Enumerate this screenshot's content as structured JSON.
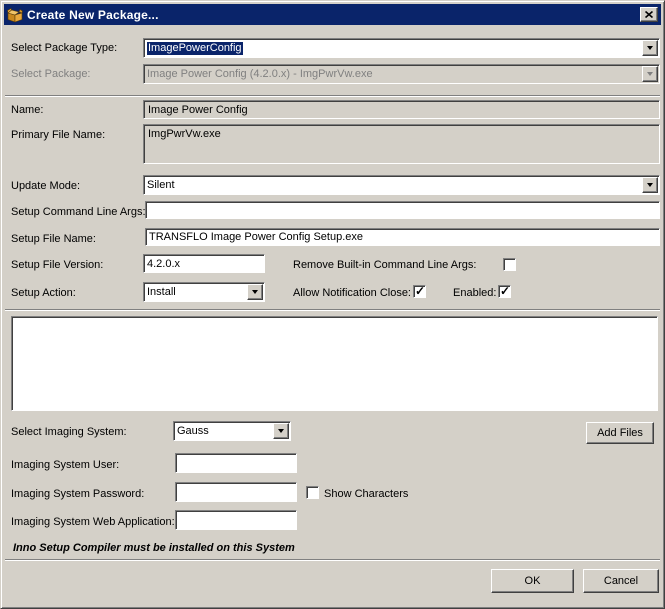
{
  "window": {
    "title": "Create New Package..."
  },
  "form": {
    "package_type": {
      "label": "Select Package Type:",
      "value": "ImagePowerConfig"
    },
    "package": {
      "label": "Select Package:",
      "value": "Image Power Config (4.2.0.x) - ImgPwrVw.exe",
      "enabled": false
    },
    "name": {
      "label": "Name:",
      "value": "Image Power Config"
    },
    "primary_file": {
      "label": "Primary File Name:",
      "value": "ImgPwrVw.exe"
    },
    "update_mode": {
      "label": "Update Mode:",
      "value": "Silent"
    },
    "cmd_args": {
      "label": "Setup Command Line Args:",
      "value": ""
    },
    "setup_file_name": {
      "label": "Setup File Name:",
      "value": "TRANSFLO Image Power Config Setup.exe"
    },
    "setup_file_version": {
      "label": "Setup File Version:",
      "value": "4.2.0.x"
    },
    "remove_args": {
      "label": "Remove Built-in Command Line Args:",
      "checked": false
    },
    "setup_action": {
      "label": "Setup Action:",
      "value": "Install"
    },
    "allow_close": {
      "label": "Allow Notification Close:",
      "checked": true
    },
    "enabled_flag": {
      "label": "Enabled:",
      "checked": true
    },
    "imaging_system": {
      "label": "Select Imaging System:",
      "value": "Gauss"
    },
    "imaging_user": {
      "label": "Imaging System User:",
      "value": ""
    },
    "imaging_password": {
      "label": "Imaging System Password:",
      "value": ""
    },
    "show_characters": {
      "label": "Show Characters",
      "checked": false
    },
    "imaging_webapp": {
      "label": "Imaging System Web Application:",
      "value": ""
    }
  },
  "file_list": {
    "items": []
  },
  "buttons": {
    "add_files": "Add Files",
    "ok": "OK",
    "cancel": "Cancel"
  },
  "note": "Inno Setup Compiler must be installed on this System",
  "colors": {
    "titlebar": "#0a246a",
    "dialog_bg": "#d4d0c8",
    "highlight": "#0a246a"
  }
}
